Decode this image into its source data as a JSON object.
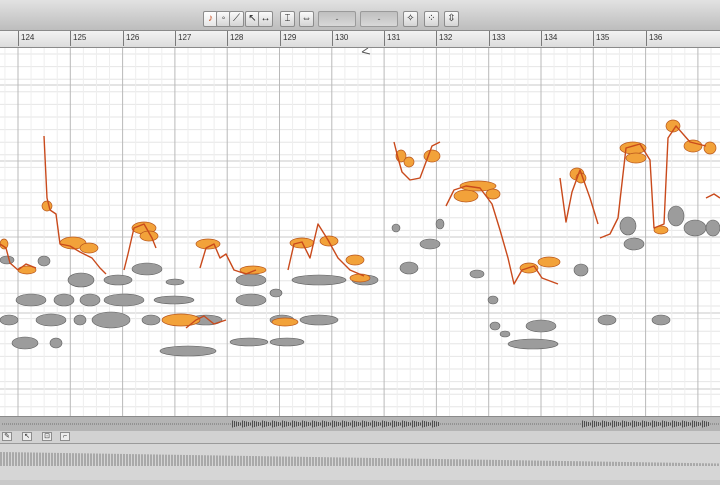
{
  "toolbar": {
    "tools": [
      {
        "name": "pitch-tool",
        "glyph": "♪",
        "active": true
      },
      {
        "name": "blob-tool",
        "glyph": "◦",
        "active": false
      },
      {
        "name": "amplitude-tool",
        "glyph": "⟋",
        "active": false
      },
      {
        "name": "main-tool",
        "glyph": "↖",
        "active": false
      },
      {
        "name": "time-tool",
        "glyph": "↔",
        "active": false
      },
      {
        "name": "pitch-drift-tool",
        "glyph": "⌶",
        "active": false
      },
      {
        "name": "formant-tool",
        "glyph": "⇔",
        "active": false
      },
      {
        "name": "zoom-in-tool",
        "glyph": "✧",
        "active": false
      },
      {
        "name": "zoom-out-tool",
        "glyph": "⁘",
        "active": false
      },
      {
        "name": "fit-tool",
        "glyph": "⇳",
        "active": false
      }
    ],
    "field_1": "-",
    "field_2": "-"
  },
  "ruler": {
    "bars": [
      "124",
      "125",
      "126",
      "127",
      "128",
      "129",
      "130",
      "131",
      "132",
      "133",
      "134",
      "135",
      "136"
    ]
  },
  "statusbar": {
    "buttons": [
      "✎",
      "↖",
      "⊡",
      "⌐"
    ]
  },
  "colors": {
    "pitch_curve": "#c94a1c",
    "blob_orange": "#f2a23a",
    "blob_gray": "#9c9c9c",
    "grid_line": "#e6e6e6",
    "grid_line_strong": "#c8c8c8"
  }
}
